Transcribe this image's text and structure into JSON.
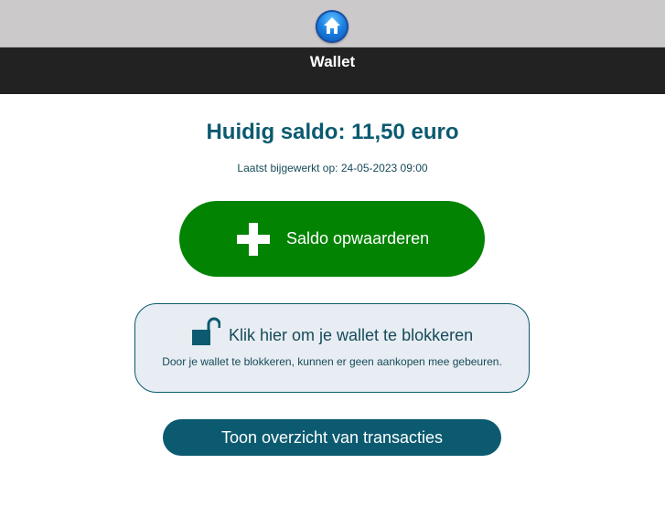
{
  "header": {
    "home_icon": "home-icon",
    "title": "Wallet"
  },
  "wallet": {
    "balance_text": "Huidig saldo: 11,50 euro",
    "updated_text": "Laatst bijgewerkt op: 24-05-2023 09:00"
  },
  "actions": {
    "topup_icon": "plus-icon",
    "topup_label": "Saldo opwaarderen",
    "block_icon": "unlock-icon",
    "block_label": "Klik hier om je wallet te blokkeren",
    "block_description": "Door je wallet te blokkeren, kunnen er geen aankopen mee gebeuren.",
    "transactions_label": "Toon overzicht van transacties"
  },
  "colors": {
    "header_gray": "#cbc9ca",
    "titlebar_dark": "#222222",
    "accent_teal": "#0b5a70",
    "topup_green": "#028302",
    "block_bg": "#e7edf2"
  }
}
